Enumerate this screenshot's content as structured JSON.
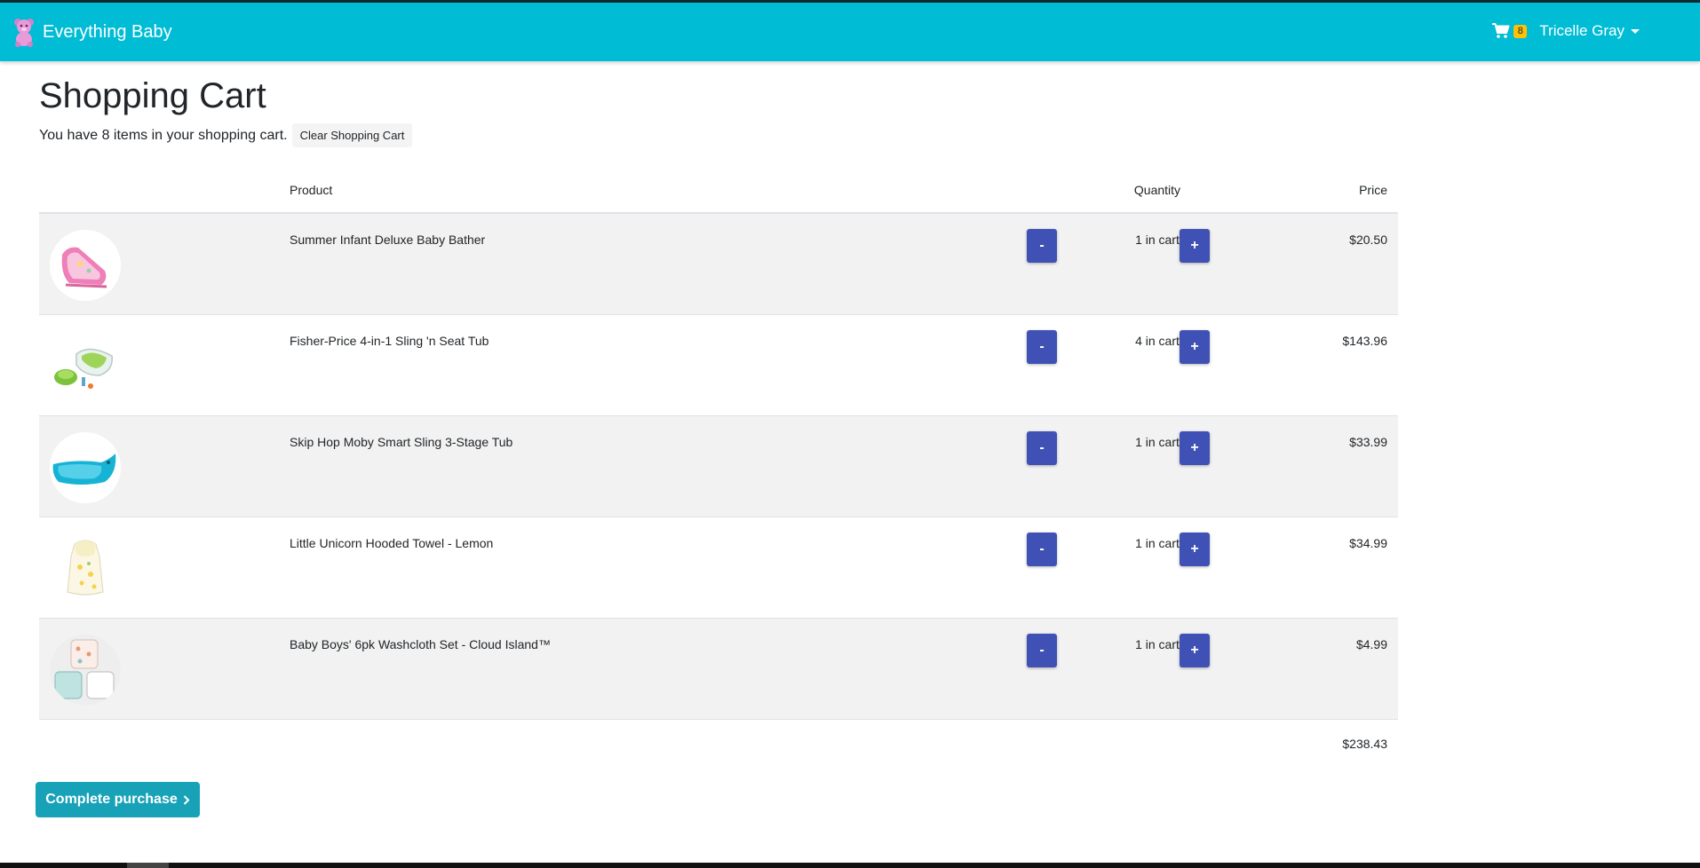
{
  "app": {
    "brand_name": "Everything Baby",
    "brand_color": "#00bcd4"
  },
  "nav": {
    "cart_count": "8",
    "user_name": "Tricelle Gray"
  },
  "page": {
    "title": "Shopping Cart",
    "summary_text": "You have 8 items in your shopping cart.",
    "clear_label": "Clear Shopping Cart"
  },
  "table": {
    "headers": {
      "product": "Product",
      "quantity": "Quantity",
      "price": "Price"
    },
    "rows": [
      {
        "name": "Summer Infant Deluxe Baby Bather",
        "quantity": "1 in cart",
        "price": "$20.50",
        "minus": "-",
        "plus": "+"
      },
      {
        "name": "Fisher-Price 4-in-1 Sling 'n Seat Tub",
        "quantity": "4 in cart",
        "price": "$143.96",
        "minus": "-",
        "plus": "+"
      },
      {
        "name": "Skip Hop Moby Smart Sling 3-Stage Tub",
        "quantity": "1 in cart",
        "price": "$33.99",
        "minus": "-",
        "plus": "+"
      },
      {
        "name": "Little Unicorn Hooded Towel - Lemon",
        "quantity": "1 in cart",
        "price": "$34.99",
        "minus": "-",
        "plus": "+"
      },
      {
        "name": "Baby Boys' 6pk Washcloth Set - Cloud Island™",
        "quantity": "1 in cart",
        "price": "$4.99",
        "minus": "-",
        "plus": "+"
      }
    ],
    "total": "$238.43"
  },
  "checkout": {
    "label": "Complete purchase",
    "color": "#17a2b8"
  },
  "colors": {
    "qty_button": "#3f51b5",
    "badge": "#ffc107",
    "row_stripe": "#f2f2f2"
  }
}
